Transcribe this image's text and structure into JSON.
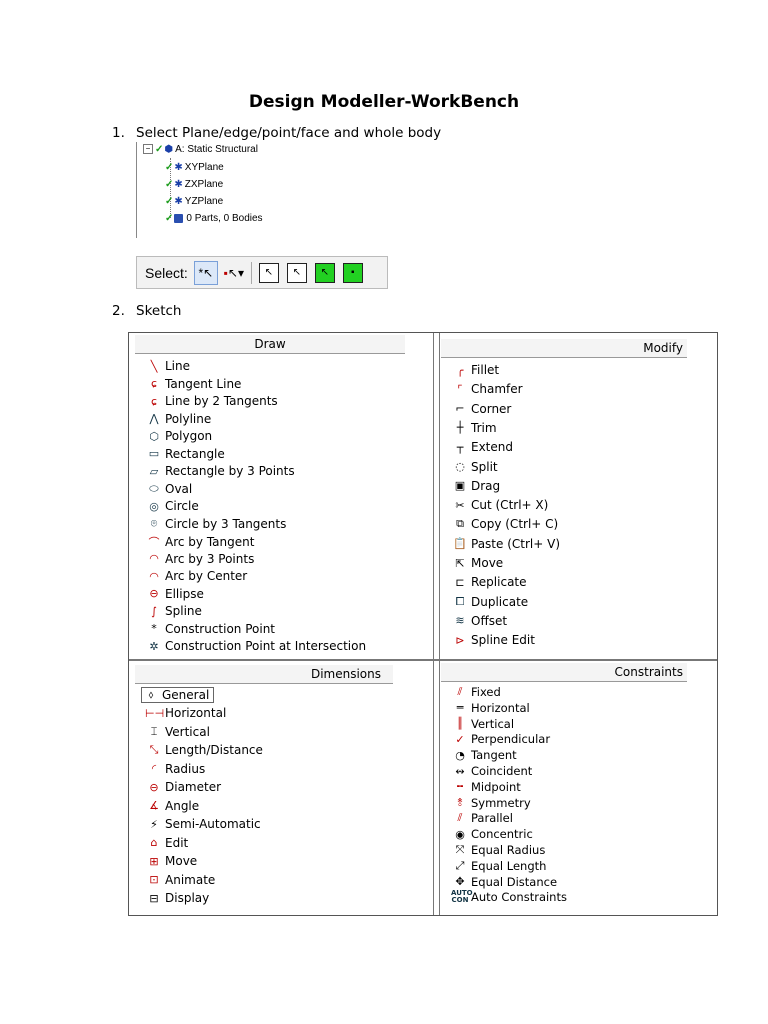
{
  "title": "Design Modeller-WorkBench",
  "steps": [
    {
      "num": "1.",
      "text": "Select Plane/edge/point/face and whole body"
    },
    {
      "num": "2.",
      "text": "Sketch"
    }
  ],
  "tree": {
    "root": "A: Static Structural",
    "children": [
      "XYPlane",
      "ZXPlane",
      "YZPlane",
      "0 Parts, 0 Bodies"
    ]
  },
  "toolbar": {
    "label": "Select:"
  },
  "draw": {
    "header": "Draw",
    "items": [
      "Line",
      "Tangent Line",
      "Line by 2 Tangents",
      "Polyline",
      "Polygon",
      "Rectangle",
      "Rectangle by 3 Points",
      "Oval",
      "Circle",
      "Circle by 3 Tangents",
      "Arc by Tangent",
      "Arc by 3 Points",
      "Arc by Center",
      "Ellipse",
      "Spline",
      "Construction Point",
      "Construction Point at Intersection"
    ]
  },
  "modify": {
    "header": "Modify",
    "items": [
      "Fillet",
      "Chamfer",
      "Corner",
      "Trim",
      "Extend",
      "Split",
      "Drag",
      "Cut (Ctrl+ X)",
      "Copy (Ctrl+ C)",
      "Paste (Ctrl+ V)",
      "Move",
      "Replicate",
      "Duplicate",
      "Offset",
      "Spline Edit"
    ]
  },
  "dimensions": {
    "header": "Dimensions",
    "items": [
      "General",
      "Horizontal",
      "Vertical",
      "Length/Distance",
      "Radius",
      "Diameter",
      "Angle",
      "Semi-Automatic",
      "Edit",
      "Move",
      "Animate",
      "Display"
    ]
  },
  "constraints": {
    "header": "Constraints",
    "items": [
      "Fixed",
      "Horizontal",
      "Vertical",
      "Perpendicular",
      "Tangent",
      "Coincident",
      "Midpoint",
      "Symmetry",
      "Parallel",
      "Concentric",
      "Equal Radius",
      "Equal Length",
      "Equal Distance",
      "Auto Constraints"
    ]
  },
  "icons": {
    "draw": [
      "line-icon",
      "tangent-line-icon",
      "line-2-tangents-icon",
      "polyline-icon",
      "polygon-icon",
      "rectangle-icon",
      "rectangle-3pts-icon",
      "oval-icon",
      "circle-icon",
      "circle-3-tangents-icon",
      "arc-tangent-icon",
      "arc-3pts-icon",
      "arc-center-icon",
      "ellipse-icon",
      "spline-icon",
      "construction-point-icon",
      "construction-point-intersection-icon"
    ]
  }
}
